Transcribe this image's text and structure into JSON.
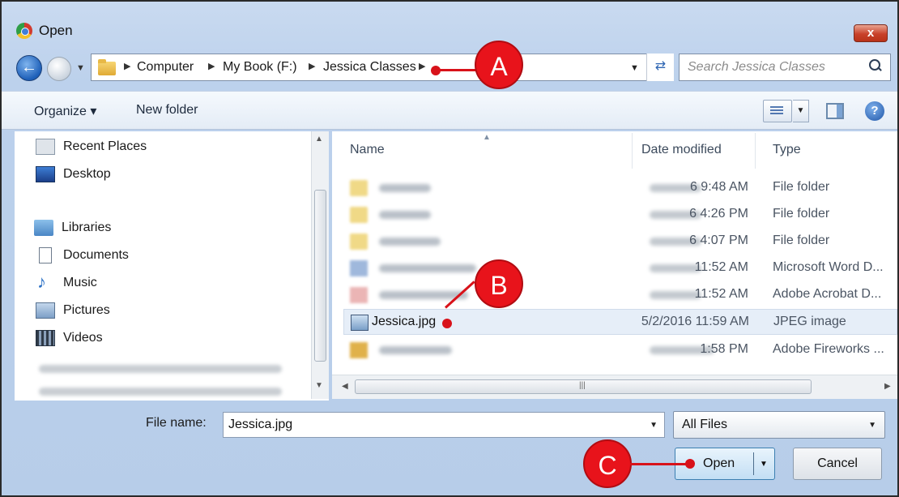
{
  "window": {
    "title": "Open",
    "close_label": "x"
  },
  "navigation": {
    "back_glyph": "←",
    "breadcrumbs": [
      "Computer",
      "My Book (F:)",
      "Jessica Classes"
    ],
    "search_placeholder": "Search Jessica Classes"
  },
  "toolbar": {
    "organize_label": "Organize ▾",
    "new_folder_label": "New folder",
    "help_glyph": "?"
  },
  "sidebar": {
    "items": [
      {
        "label": "Recent Places",
        "icon": "recent-places-icon"
      },
      {
        "label": "Desktop",
        "icon": "desktop-icon"
      },
      {
        "label": "Libraries",
        "icon": "libraries-icon"
      },
      {
        "label": "Documents",
        "icon": "documents-icon"
      },
      {
        "label": "Music",
        "icon": "music-icon"
      },
      {
        "label": "Pictures",
        "icon": "pictures-icon"
      },
      {
        "label": "Videos",
        "icon": "videos-icon"
      }
    ]
  },
  "file_list": {
    "columns": [
      "Name",
      "Date modified",
      "Type"
    ],
    "rows": [
      {
        "name": "",
        "date": "6 9:48 AM",
        "type": "File folder",
        "icon": "folder-icon"
      },
      {
        "name": "",
        "date": "6 4:26 PM",
        "type": "File folder",
        "icon": "folder-icon"
      },
      {
        "name": "",
        "date": "6 4:07 PM",
        "type": "File folder",
        "icon": "folder-icon"
      },
      {
        "name": "",
        "date": "11:52 AM",
        "type": "Microsoft Word D...",
        "icon": "word-document-icon"
      },
      {
        "name": "",
        "date": "11:52 AM",
        "type": "Adobe Acrobat D...",
        "icon": "pdf-document-icon"
      },
      {
        "name": "Jessica.jpg",
        "date": "5/2/2016 11:59 AM",
        "type": "JPEG image",
        "icon": "image-file-icon",
        "selected": true
      },
      {
        "name": "",
        "date": "1:58 PM",
        "type": "Adobe Fireworks ...",
        "icon": "fireworks-file-icon"
      }
    ]
  },
  "footer": {
    "file_name_label": "File name:",
    "file_name_value": "Jessica.jpg",
    "file_type_value": "All Files",
    "open_label": "Open",
    "cancel_label": "Cancel"
  },
  "annotations": {
    "a": "A",
    "b": "B",
    "c": "C"
  },
  "colors": {
    "callout": "#e8131b",
    "selection": "#e6eef8",
    "title_bar": "#c9daf0"
  }
}
